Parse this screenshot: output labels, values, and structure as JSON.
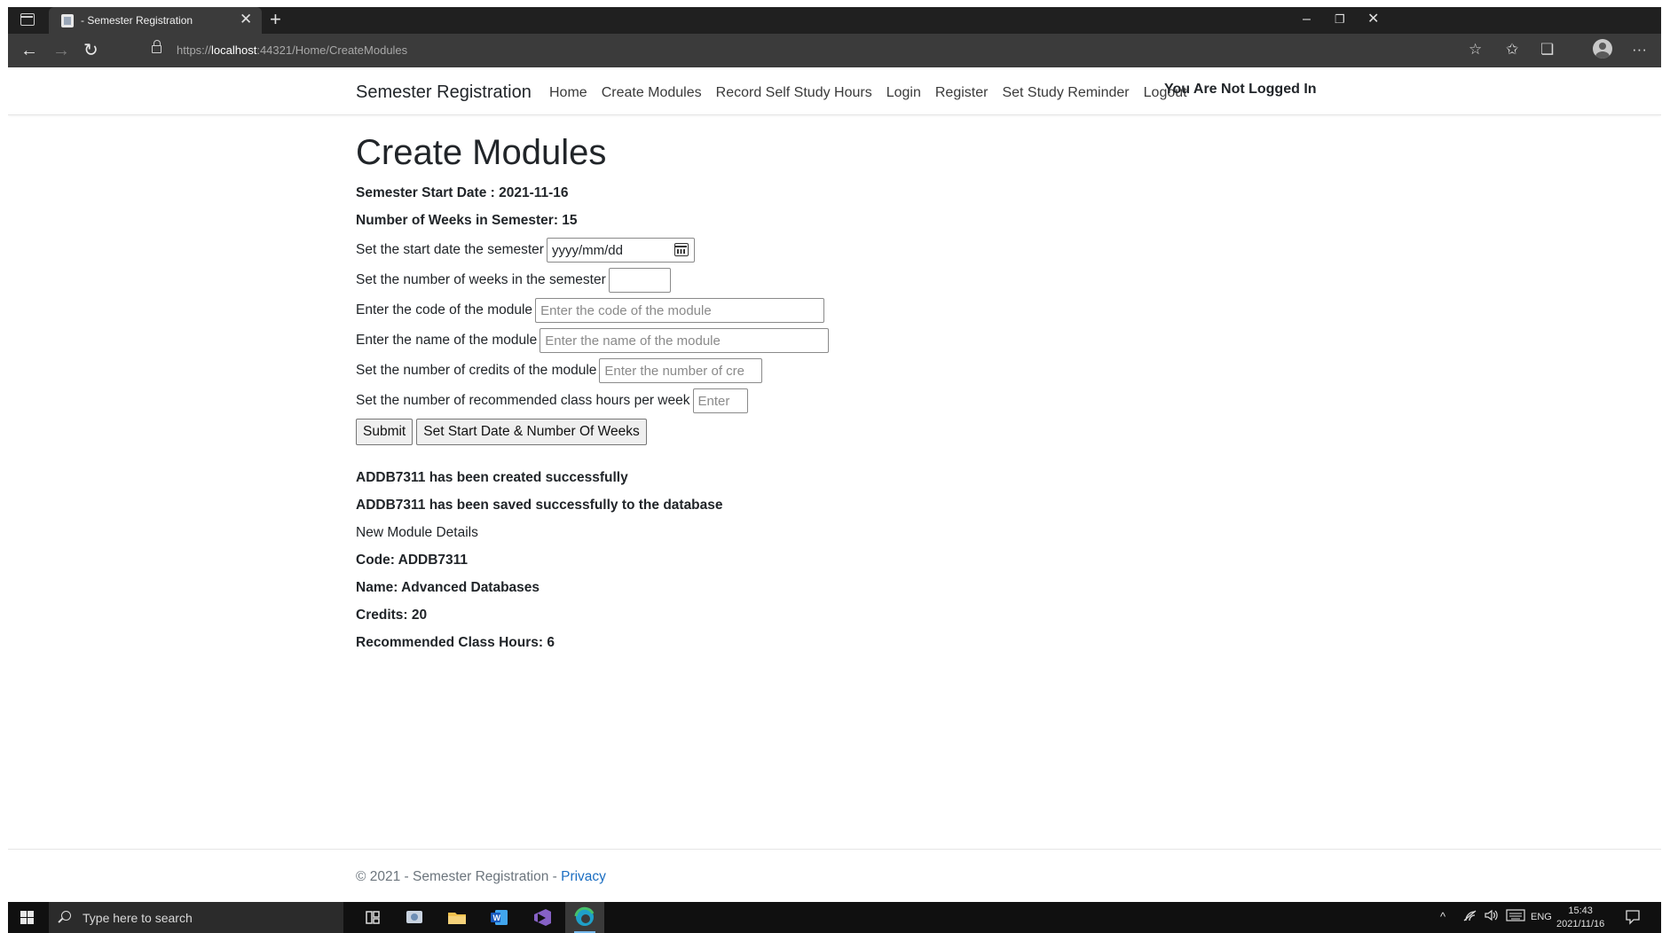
{
  "browser": {
    "tab_title": "- Semester Registration",
    "tab_close": "✕",
    "new_tab": "+",
    "url_scheme": "https://",
    "url_host": "localhost",
    "url_path": ":44321/Home/CreateModules",
    "window_controls": {
      "minimize": "–",
      "restore": "❐",
      "close": "✕"
    },
    "nav": {
      "back": "←",
      "forward": "→",
      "refresh": "↻"
    },
    "toolbar_icons": {
      "add_favorite": "☆",
      "favorites": "✩",
      "collections": "❏",
      "more": "···"
    }
  },
  "navbar": {
    "brand": "Semester Registration",
    "links": [
      "Home",
      "Create Modules",
      "Record Self Study Hours",
      "Login",
      "Register",
      "Set Study Reminder",
      "Logout"
    ],
    "login_status": "You Are Not Logged In"
  },
  "page": {
    "title": "Create Modules",
    "semester_start": "Semester Start Date : 2021-11-16",
    "semester_weeks": "Number of Weeks in Semester: 15",
    "form": {
      "start_date_label": "Set the start date the semester",
      "start_date_value": "yyyy/mm/dd",
      "weeks_label": "Set the number of weeks in the semester",
      "weeks_value": "",
      "code_label": "Enter the code of the module",
      "code_placeholder": "Enter the code of the module",
      "name_label": "Enter the name of the module",
      "name_placeholder": "Enter the name of the module",
      "credits_label": "Set the number of credits of the module",
      "credits_placeholder": "Enter the number of cre",
      "hours_label": "Set the number of recommended class hours per week",
      "hours_placeholder": "Enter",
      "submit_label": "Submit",
      "set_start_label": "Set Start Date & Number Of Weeks"
    },
    "results": {
      "created": "ADDB7311 has been created successfully",
      "saved": "ADDB7311 has been saved successfully to the database",
      "details_heading": "New Module Details",
      "code": "Code: ADDB7311",
      "name": "Name: Advanced Databases",
      "credits": "Credits: 20",
      "hours": "Recommended Class Hours: 6"
    }
  },
  "footer": {
    "text": "© 2021 - Semester Registration - ",
    "privacy": "Privacy"
  },
  "taskbar": {
    "search_placeholder": "Type here to search",
    "apps": [
      "task-view",
      "snipping-tool",
      "file-explorer",
      "word",
      "visual-studio",
      "edge"
    ],
    "tray_chevron": "^",
    "language": "ENG",
    "time": "15:43",
    "date": "2021/11/16"
  }
}
